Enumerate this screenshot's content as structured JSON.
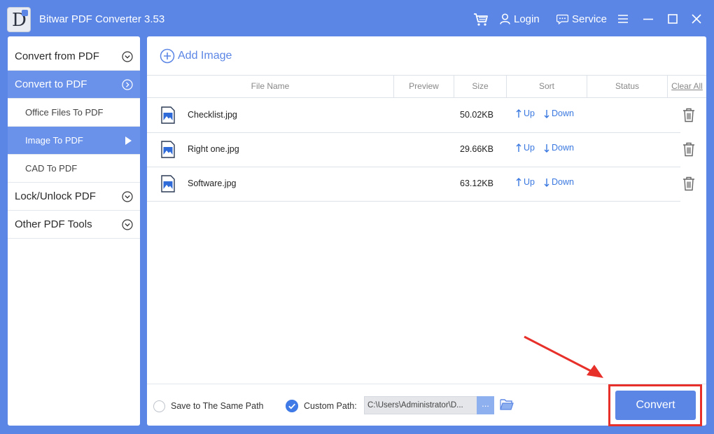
{
  "window": {
    "title": "Bitwar PDF Converter 3.53",
    "logo_letter": "D",
    "login_label": "Login",
    "service_label": "Service",
    "brand_color": "#5b86e5"
  },
  "sidebar": {
    "convert_from_pdf": "Convert from PDF",
    "convert_to_pdf": "Convert to PDF",
    "sub_items": [
      "Office Files To PDF",
      "Image To PDF",
      "CAD To PDF"
    ],
    "lock_unlock": "Lock/Unlock PDF",
    "other_tools": "Other PDF Tools",
    "active_sub": "Image To PDF"
  },
  "main": {
    "add_image_label": "Add Image",
    "columns": {
      "file_name": "File Name",
      "preview": "Preview",
      "size": "Size",
      "sort": "Sort",
      "status": "Status",
      "clear_all": "Clear All"
    },
    "rows": [
      {
        "name": "Checklist.jpg",
        "size": "50.02KB",
        "up": "Up",
        "down": "Down"
      },
      {
        "name": "Right one.jpg",
        "size": "29.66KB",
        "up": "Up",
        "down": "Down"
      },
      {
        "name": "Software.jpg",
        "size": "63.12KB",
        "up": "Up",
        "down": "Down"
      }
    ]
  },
  "bottom": {
    "same_path_label": "Save to The Same Path",
    "custom_path_label": "Custom Path:",
    "path_value": "C:\\Users\\Administrator\\D...",
    "more_label": "...",
    "convert_label": "Convert",
    "highlight_color": "#e8302a"
  }
}
